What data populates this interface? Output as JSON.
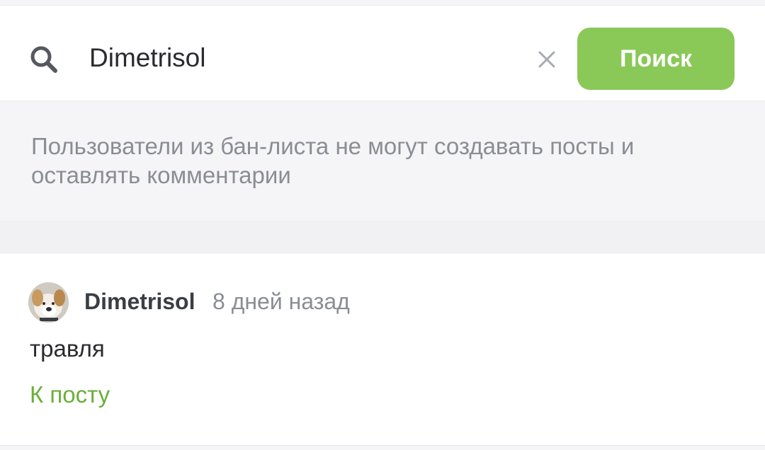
{
  "search": {
    "query": "Dimetrisol",
    "button_label": "Поиск",
    "icon": "search-icon",
    "clear_icon": "close-icon"
  },
  "notice": {
    "text": "Пользователи из бан-листа не могут создавать посты и оставлять комментарии"
  },
  "comment": {
    "author": "Dimetrisol",
    "time": "8 дней назад",
    "text": "травля",
    "link_label": "К посту"
  },
  "colors": {
    "accent": "#8ac858",
    "link": "#6aaf3a",
    "muted": "#8a8d94"
  }
}
